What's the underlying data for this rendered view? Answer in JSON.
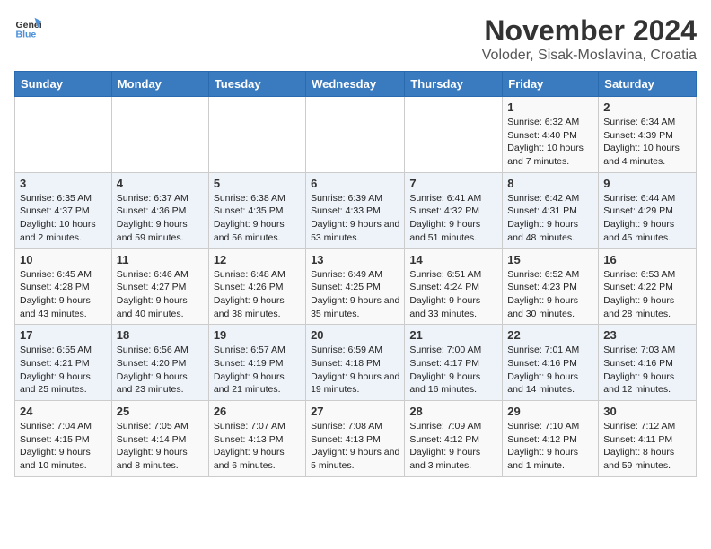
{
  "header": {
    "logo_general": "General",
    "logo_blue": "Blue",
    "month_title": "November 2024",
    "location": "Voloder, Sisak-Moslavina, Croatia"
  },
  "days_of_week": [
    "Sunday",
    "Monday",
    "Tuesday",
    "Wednesday",
    "Thursday",
    "Friday",
    "Saturday"
  ],
  "weeks": [
    [
      {
        "day": "",
        "info": ""
      },
      {
        "day": "",
        "info": ""
      },
      {
        "day": "",
        "info": ""
      },
      {
        "day": "",
        "info": ""
      },
      {
        "day": "",
        "info": ""
      },
      {
        "day": "1",
        "info": "Sunrise: 6:32 AM\nSunset: 4:40 PM\nDaylight: 10 hours and 7 minutes."
      },
      {
        "day": "2",
        "info": "Sunrise: 6:34 AM\nSunset: 4:39 PM\nDaylight: 10 hours and 4 minutes."
      }
    ],
    [
      {
        "day": "3",
        "info": "Sunrise: 6:35 AM\nSunset: 4:37 PM\nDaylight: 10 hours and 2 minutes."
      },
      {
        "day": "4",
        "info": "Sunrise: 6:37 AM\nSunset: 4:36 PM\nDaylight: 9 hours and 59 minutes."
      },
      {
        "day": "5",
        "info": "Sunrise: 6:38 AM\nSunset: 4:35 PM\nDaylight: 9 hours and 56 minutes."
      },
      {
        "day": "6",
        "info": "Sunrise: 6:39 AM\nSunset: 4:33 PM\nDaylight: 9 hours and 53 minutes."
      },
      {
        "day": "7",
        "info": "Sunrise: 6:41 AM\nSunset: 4:32 PM\nDaylight: 9 hours and 51 minutes."
      },
      {
        "day": "8",
        "info": "Sunrise: 6:42 AM\nSunset: 4:31 PM\nDaylight: 9 hours and 48 minutes."
      },
      {
        "day": "9",
        "info": "Sunrise: 6:44 AM\nSunset: 4:29 PM\nDaylight: 9 hours and 45 minutes."
      }
    ],
    [
      {
        "day": "10",
        "info": "Sunrise: 6:45 AM\nSunset: 4:28 PM\nDaylight: 9 hours and 43 minutes."
      },
      {
        "day": "11",
        "info": "Sunrise: 6:46 AM\nSunset: 4:27 PM\nDaylight: 9 hours and 40 minutes."
      },
      {
        "day": "12",
        "info": "Sunrise: 6:48 AM\nSunset: 4:26 PM\nDaylight: 9 hours and 38 minutes."
      },
      {
        "day": "13",
        "info": "Sunrise: 6:49 AM\nSunset: 4:25 PM\nDaylight: 9 hours and 35 minutes."
      },
      {
        "day": "14",
        "info": "Sunrise: 6:51 AM\nSunset: 4:24 PM\nDaylight: 9 hours and 33 minutes."
      },
      {
        "day": "15",
        "info": "Sunrise: 6:52 AM\nSunset: 4:23 PM\nDaylight: 9 hours and 30 minutes."
      },
      {
        "day": "16",
        "info": "Sunrise: 6:53 AM\nSunset: 4:22 PM\nDaylight: 9 hours and 28 minutes."
      }
    ],
    [
      {
        "day": "17",
        "info": "Sunrise: 6:55 AM\nSunset: 4:21 PM\nDaylight: 9 hours and 25 minutes."
      },
      {
        "day": "18",
        "info": "Sunrise: 6:56 AM\nSunset: 4:20 PM\nDaylight: 9 hours and 23 minutes."
      },
      {
        "day": "19",
        "info": "Sunrise: 6:57 AM\nSunset: 4:19 PM\nDaylight: 9 hours and 21 minutes."
      },
      {
        "day": "20",
        "info": "Sunrise: 6:59 AM\nSunset: 4:18 PM\nDaylight: 9 hours and 19 minutes."
      },
      {
        "day": "21",
        "info": "Sunrise: 7:00 AM\nSunset: 4:17 PM\nDaylight: 9 hours and 16 minutes."
      },
      {
        "day": "22",
        "info": "Sunrise: 7:01 AM\nSunset: 4:16 PM\nDaylight: 9 hours and 14 minutes."
      },
      {
        "day": "23",
        "info": "Sunrise: 7:03 AM\nSunset: 4:16 PM\nDaylight: 9 hours and 12 minutes."
      }
    ],
    [
      {
        "day": "24",
        "info": "Sunrise: 7:04 AM\nSunset: 4:15 PM\nDaylight: 9 hours and 10 minutes."
      },
      {
        "day": "25",
        "info": "Sunrise: 7:05 AM\nSunset: 4:14 PM\nDaylight: 9 hours and 8 minutes."
      },
      {
        "day": "26",
        "info": "Sunrise: 7:07 AM\nSunset: 4:13 PM\nDaylight: 9 hours and 6 minutes."
      },
      {
        "day": "27",
        "info": "Sunrise: 7:08 AM\nSunset: 4:13 PM\nDaylight: 9 hours and 5 minutes."
      },
      {
        "day": "28",
        "info": "Sunrise: 7:09 AM\nSunset: 4:12 PM\nDaylight: 9 hours and 3 minutes."
      },
      {
        "day": "29",
        "info": "Sunrise: 7:10 AM\nSunset: 4:12 PM\nDaylight: 9 hours and 1 minute."
      },
      {
        "day": "30",
        "info": "Sunrise: 7:12 AM\nSunset: 4:11 PM\nDaylight: 8 hours and 59 minutes."
      }
    ]
  ]
}
